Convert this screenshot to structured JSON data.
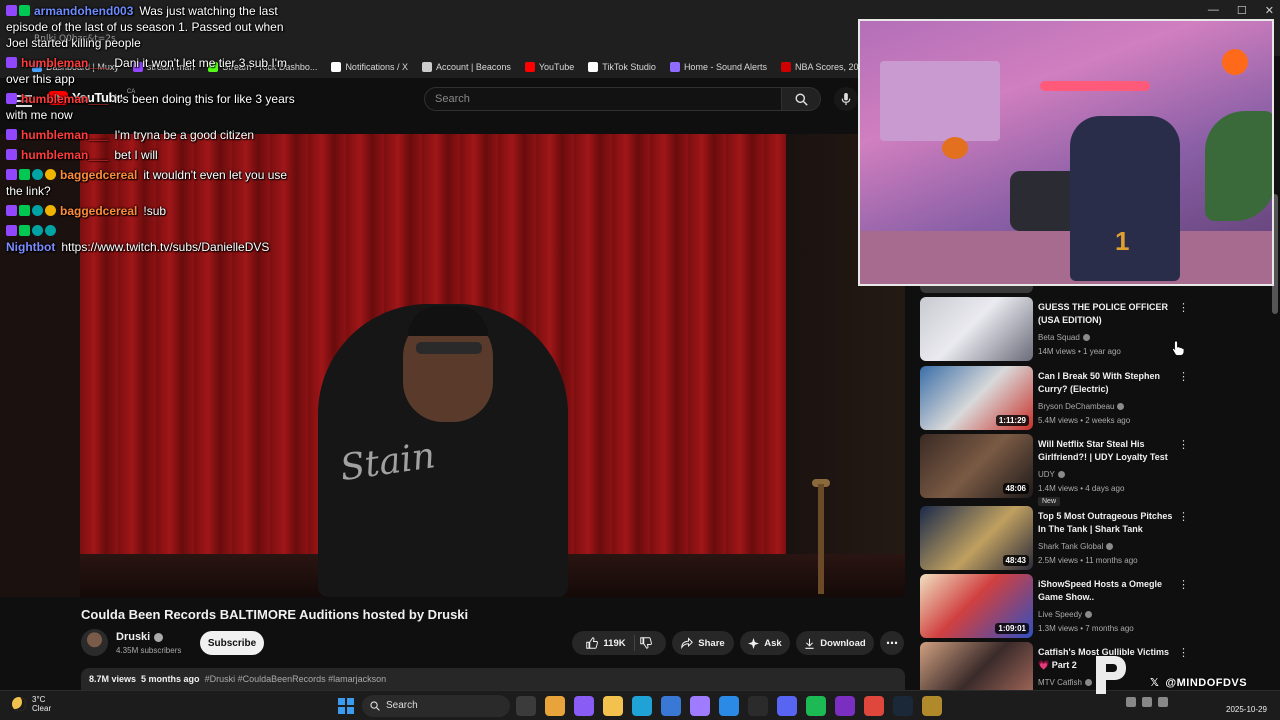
{
  "window": {
    "controls": [
      "—",
      "☐",
      "✕"
    ]
  },
  "browser": {
    "url_fragment": "Rnlkj Q0hzc&t=2s",
    "bookmarks": [
      {
        "label": "Dashboard | Muxy",
        "color": "#4aa3ff"
      },
      {
        "label": "stream man",
        "color": "#9146ff"
      },
      {
        "label": "Stream - Kick Dashbo...",
        "color": "#53fc18"
      },
      {
        "label": "Notifications / X",
        "color": "#ffffff"
      },
      {
        "label": "Account | Beacons",
        "color": "#cccccc"
      },
      {
        "label": "YouTube",
        "color": "#ff0000"
      },
      {
        "label": "TikTok Studio",
        "color": "#ffffff"
      },
      {
        "label": "Home - Sound Alerts",
        "color": "#8f6bff"
      },
      {
        "label": "NBA Scores, 2024-2...",
        "color": "#d00000"
      },
      {
        "label": "ARCN St",
        "color": "#2ecc71"
      }
    ]
  },
  "youtube": {
    "logo_text": "YouTube",
    "region": "CA",
    "search_placeholder": "Search"
  },
  "video": {
    "title": "Coulda Been Records BALTIMORE Auditions hosted by Druski",
    "hoodie_text": "Stain"
  },
  "channel": {
    "name": "Druski",
    "subscribers": "4.35M subscribers",
    "subscribe_label": "Subscribe"
  },
  "actions": {
    "likes": "119K",
    "share_label": "Share",
    "ask_label": "Ask",
    "download_label": "Download",
    "more_label": "⋯"
  },
  "description": {
    "views": "8.7M views",
    "age": "5 months ago",
    "tags": "#Druski #CouldaBeenRecords #lamarjackson"
  },
  "chat": [
    {
      "user": "armandohend003",
      "user_color": "#6e8cff",
      "badges": [
        "purple",
        "green"
      ],
      "message": "Was just watching the last episode of the last of us season 1. Passed out when Joel started killing people"
    },
    {
      "user": "humbleman___",
      "user_color": "#ff3b3b",
      "badges": [
        "purple"
      ],
      "message": "Dani it won't let me tier 3 sub I'm over this app"
    },
    {
      "user": "humbleman___",
      "user_color": "#ff3b3b",
      "badges": [
        "purple"
      ],
      "message": "it's been doing this for like 3 years with me now"
    },
    {
      "user": "humbleman___",
      "user_color": "#ff3b3b",
      "badges": [
        "purple"
      ],
      "message": "I'm tryna be a good citizen"
    },
    {
      "user": "humbleman___",
      "user_color": "#ff3b3b",
      "badges": [
        "purple"
      ],
      "message": "bet I will"
    },
    {
      "user": "baggedcereal",
      "user_color": "#ff8c3a",
      "badges": [
        "purple",
        "green",
        "teal",
        "gold"
      ],
      "message": "it wouldn't even let you use the link?"
    },
    {
      "user": "baggedcereal",
      "user_color": "#ff8c3a",
      "badges": [
        "purple",
        "green",
        "teal",
        "gold"
      ],
      "message": "!sub"
    },
    {
      "user": "Nightbot",
      "user_color": "#7b8cff",
      "badges": [
        "purple",
        "green",
        "teal",
        "teal"
      ],
      "message": "https://www.twitch.tv/subs/DanielleDVS"
    }
  ],
  "webcam": {
    "jersey_number": "1"
  },
  "recommended": [
    {
      "title": "GUESS THE POLICE OFFICER (USA EDITION)",
      "channel": "Beta Squad",
      "stats": "14M views • 1 year ago",
      "duration": "",
      "new": "",
      "thumb": "linear-gradient(135deg,#c9c9d1,#eaeaf0 45%,#6b6b7a)"
    },
    {
      "title": "Can I Break 50 With Stephen Curry? (Electric)",
      "channel": "Bryson DeChambeau",
      "stats": "5.4M views • 2 weeks ago",
      "duration": "1:11:29",
      "new": "",
      "thumb": "linear-gradient(135deg,#3a6ea8,#d9d9d9 50%,#c8302a)"
    },
    {
      "title": "Will Netflix Star Steal His Girlfriend?! | UDY Loyalty Test",
      "channel": "UDY",
      "stats": "1.4M views • 4 days ago",
      "duration": "48:06",
      "new": "New",
      "thumb": "linear-gradient(135deg,#3a2a24,#7a5a44 50%,#1e1a1a)"
    },
    {
      "title": "Top 5 Most Outrageous Pitches In The Tank | Shark Tank",
      "channel": "Shark Tank Global",
      "stats": "2.5M views • 11 months ago",
      "duration": "48:43",
      "new": "",
      "thumb": "linear-gradient(135deg,#1a2a4a,#c0a060 55%,#2a2a3a)"
    },
    {
      "title": "iShowSpeed Hosts a Omegle Game Show..",
      "channel": "Live Speedy",
      "stats": "1.3M views • 7 months ago",
      "duration": "1:09:01",
      "new": "",
      "thumb": "linear-gradient(135deg,#f0e0c0,#d04040 45%,#3050c0)"
    },
    {
      "title": "Catfish's Most Gullible Victims 💗 Part 2",
      "channel": "MTV Catfish",
      "stats": "",
      "duration": "",
      "new": "",
      "thumb": "linear-gradient(135deg,#d0a080,#3a2a2a 50%,#b07060)"
    }
  ],
  "watermark": {
    "handle": "@MINDOFDVS",
    "x_glyph": "𝕏"
  },
  "taskbar": {
    "temperature": "3°C",
    "condition": "Clear",
    "search_label": "Search",
    "date": "2025-10-29",
    "apps": [
      {
        "name": "task-view",
        "color": "#3b3b3b"
      },
      {
        "name": "chrome",
        "color": "#e8a33a"
      },
      {
        "name": "copilot",
        "color": "#8a5cf6"
      },
      {
        "name": "file-explorer",
        "color": "#f2c14e"
      },
      {
        "name": "edge",
        "color": "#1fa3d6"
      },
      {
        "name": "store",
        "color": "#3a78d6"
      },
      {
        "name": "pen",
        "color": "#9f7bff"
      },
      {
        "name": "remote",
        "color": "#2a8ae6"
      },
      {
        "name": "obs",
        "color": "#2b2b2b"
      },
      {
        "name": "discord",
        "color": "#5865f2"
      },
      {
        "name": "spotify",
        "color": "#1db954"
      },
      {
        "name": "nzxt",
        "color": "#7a2fc0"
      },
      {
        "name": "app-red",
        "color": "#e0473c"
      },
      {
        "name": "steam",
        "color": "#1b2838"
      },
      {
        "name": "app-gold",
        "color": "#b08a2a"
      }
    ]
  }
}
